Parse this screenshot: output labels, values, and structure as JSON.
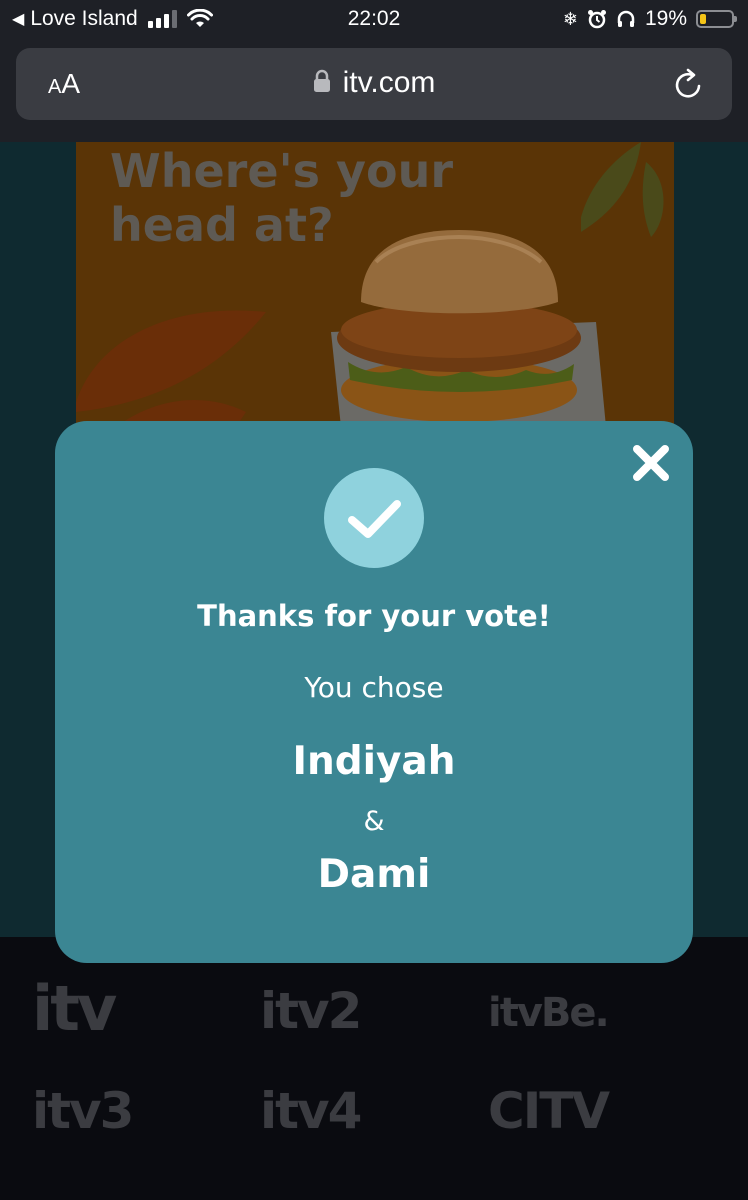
{
  "status_bar": {
    "carrier": "Love Island",
    "time": "22:02",
    "battery_percent": "19%",
    "battery_level": 0.19,
    "icons": [
      "back-arrow-icon",
      "signal-icon",
      "wifi-icon",
      "snowflake-icon",
      "alarm-icon",
      "headphones-icon",
      "battery-icon"
    ]
  },
  "browser": {
    "text_size_small": "A",
    "text_size_big": "A",
    "url": "itv.com",
    "icons": [
      "lock-icon",
      "reload-icon"
    ]
  },
  "ad": {
    "headline_line1": "Where's your",
    "headline_line2": "head at?"
  },
  "modal": {
    "title": "Thanks for your vote!",
    "subtitle": "You chose",
    "name1": "Indiyah",
    "ampersand": "&",
    "name2": "Dami",
    "icons": [
      "checkmark-icon",
      "close-icon"
    ]
  },
  "footer_logos": [
    {
      "name": "itv",
      "text": "itv"
    },
    {
      "name": "itv2",
      "text": "itv2"
    },
    {
      "name": "itvbe",
      "text": "itvBe."
    },
    {
      "name": "itv3",
      "text": "itv3"
    },
    {
      "name": "itv4",
      "text": "itv4"
    },
    {
      "name": "citv",
      "text": "CITV"
    }
  ],
  "colors": {
    "modal_bg": "#3b8693",
    "check_circle": "#8fd2dd",
    "page_teal": "#0f2a30",
    "footer_bg": "#0a0b10"
  }
}
